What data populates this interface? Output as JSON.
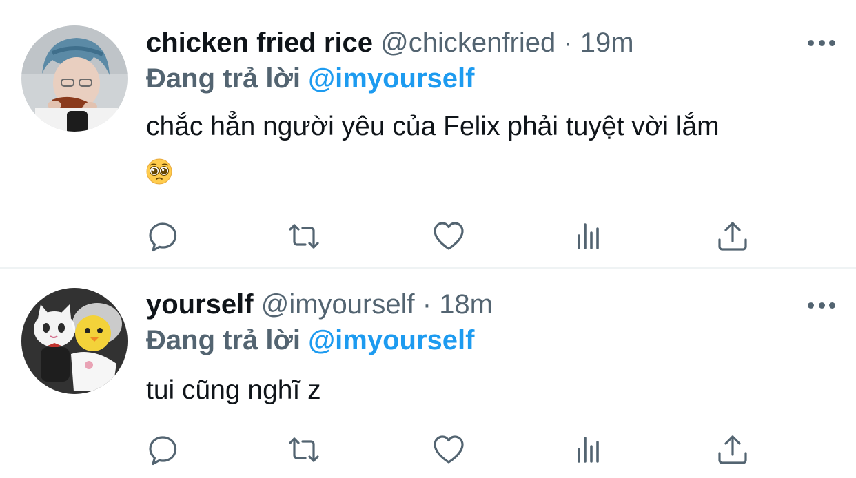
{
  "tweets": [
    {
      "name": "chicken fried rice",
      "handle": "@chickenfried",
      "separator": "·",
      "time": "19m",
      "replying_prefix": "Đang trả lời",
      "replying_to": "@imyourself",
      "text": "chắc hẳn người yêu của Felix phải tuyệt vời lắm",
      "emoji": "pleading-face"
    },
    {
      "name": "yourself",
      "handle": "@imyourself",
      "separator": "·",
      "time": "18m",
      "replying_prefix": "Đang trả lời",
      "replying_to": "@imyourself",
      "text": "tui cũng nghĩ z"
    }
  ],
  "icons": {
    "more": "more-horizontal-icon",
    "reply": "reply-bubble-icon",
    "retweet": "retweet-icon",
    "like": "heart-icon",
    "views": "analytics-icon",
    "share": "share-upload-icon"
  },
  "colors": {
    "text": "#0f1419",
    "secondary": "#536471",
    "accent": "#1d9bf0",
    "divider": "#eff3f4"
  }
}
